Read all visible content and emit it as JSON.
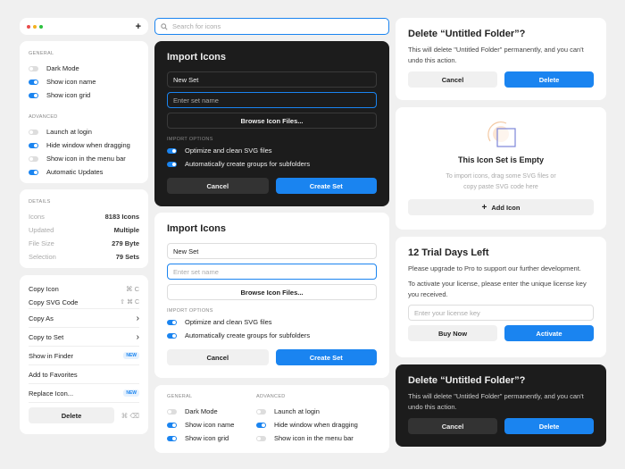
{
  "titlebar": {
    "plus": "+"
  },
  "settings": {
    "general_label": "GENERAL",
    "general": [
      {
        "label": "Dark Mode",
        "on": false
      },
      {
        "label": "Show icon name",
        "on": true
      },
      {
        "label": "Show icon grid",
        "on": true
      }
    ],
    "advanced_label": "ADVANCED",
    "advanced": [
      {
        "label": "Launch at login",
        "on": false
      },
      {
        "label": "Hide window when dragging",
        "on": true
      },
      {
        "label": "Show icon in the menu bar",
        "on": false
      },
      {
        "label": "Automatic Updates",
        "on": true
      }
    ]
  },
  "details": {
    "label": "DETAILS",
    "rows": [
      {
        "k": "Icons",
        "v": "8183 Icons"
      },
      {
        "k": "Updated",
        "v": "Multiple"
      },
      {
        "k": "File Size",
        "v": "279 Byte"
      },
      {
        "k": "Selection",
        "v": "79 Sets"
      }
    ]
  },
  "menu": {
    "copy_icon": "Copy Icon",
    "copy_icon_sc": "⌘ C",
    "copy_svg": "Copy SVG Code",
    "copy_svg_sc": "⇧ ⌘ C",
    "copy_as": "Copy As",
    "copy_to_set": "Copy to Set",
    "show_finder": "Show in Finder",
    "favorites": "Add to Favorites",
    "replace": "Replace Icon...",
    "new": "NEW",
    "delete": "Delete",
    "delete_sc": "⌘ ⌫",
    "chevron": "›"
  },
  "search": {
    "placeholder": "Search for icons"
  },
  "import": {
    "title": "Import Icons",
    "set_value": "New Set",
    "name_placeholder": "Enter set name",
    "browse": "Browse Icon Files...",
    "options_label": "IMPORT OPTIONS",
    "opt1": "Optimize and clean SVG files",
    "opt2": "Automatically create groups for subfolders",
    "cancel": "Cancel",
    "create": "Create Set"
  },
  "delete_dialog": {
    "title": "Delete “Untitled Folder”?",
    "body": "This will delete \"Untitled Folder\" permanently, and you can't undo this action.",
    "cancel": "Cancel",
    "delete": "Delete"
  },
  "empty": {
    "title": "This Icon Set is Empty",
    "body": "To import icons, drag some SVG files or copy paste SVG code here",
    "add": "Add Icon",
    "plus": "+"
  },
  "trial": {
    "title": "12 Trial Days Left",
    "p1": "Please upgrade to Pro to support our further development.",
    "p2": "To activate your license, please enter the unique license key you received.",
    "placeholder": "Enter your license key",
    "buy": "Buy Now",
    "activate": "Activate"
  },
  "colors": {
    "accent": "#1a84f0"
  }
}
